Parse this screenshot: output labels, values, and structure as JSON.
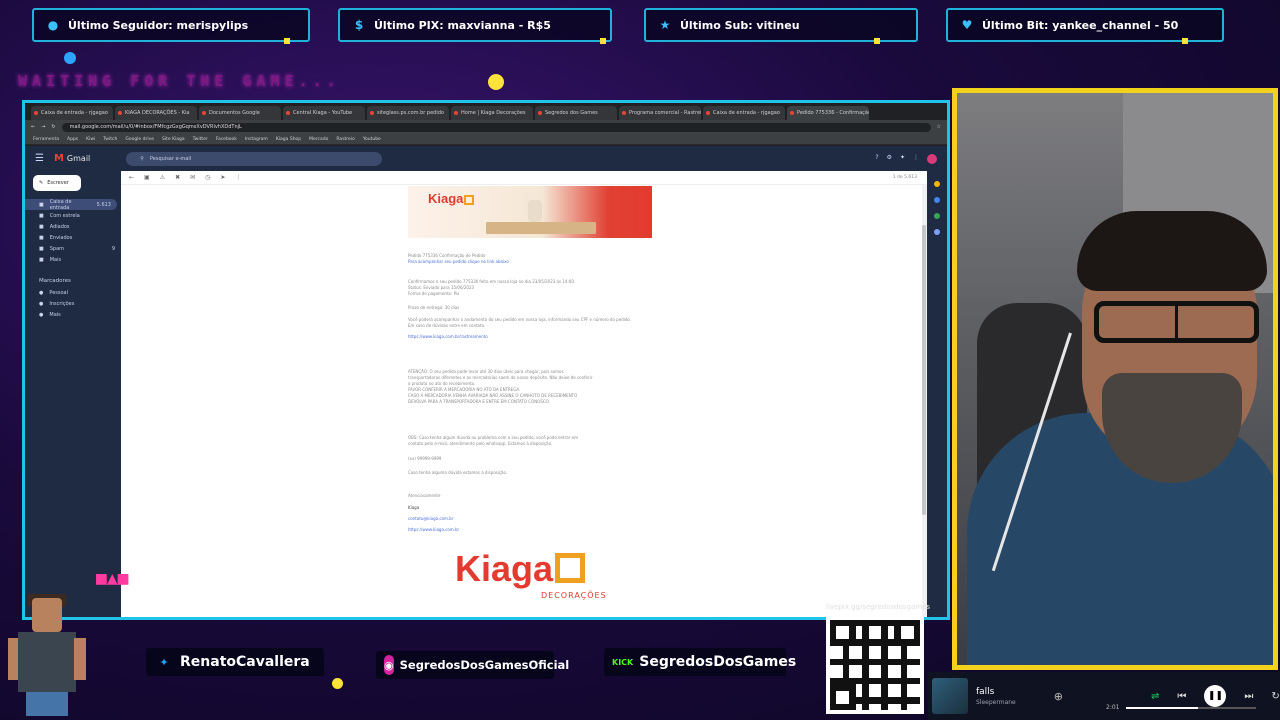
{
  "overlay": {
    "alerts": [
      {
        "icon": "user-icon",
        "label": "Último Seguidor: merispylips"
      },
      {
        "icon": "dollar-icon",
        "label": "Último PIX: maxvianna - R$5"
      },
      {
        "icon": "star-icon",
        "label": "Último Sub: vitineu"
      },
      {
        "icon": "heart-icon",
        "label": "Último Bit: yankee_channel - 50"
      }
    ],
    "waiting_text": "WAITING FOR THE GAME...",
    "socials": [
      {
        "icon": "twitter-icon",
        "label": "RenatoCavallera",
        "color": "#1da1f2"
      },
      {
        "icon": "instagram-icon",
        "label": "SegredosDosGamesOficial",
        "color": "#d6249f"
      },
      {
        "icon": "kick-icon",
        "label": "SegredosDosGames",
        "color": "#53fc18"
      }
    ],
    "qr_label": "livepix.gg/segredosdosgames",
    "accent_color": "#22c3e8",
    "webcam_border_color": "#f2d21c"
  },
  "browser": {
    "tabs": [
      "Caixa de entrada - rjgagao",
      "KIAGA DECORAÇÕES - Kia",
      "Documentos Google",
      "Central Kiaga - YouTube",
      "siteglass.ps.com.br pedido",
      "Home | Kiaga Decorações",
      "Segredos dos Games",
      "Programa comercial - Rastreio",
      "Caixa de entrada - rjgagao",
      "Pedido 775336 - Confirmação"
    ],
    "url": "mail.google.com/mail/u/0/#inbox/FMfcgzGxgGqmsXvDVRlvhXDdTnjL",
    "bookmarks": [
      "Ferramenta",
      "Apps",
      "Kiwi",
      "Twitch",
      "Google drive",
      "Site Kiaga",
      "Twitter",
      "Facebook",
      "Instagram",
      "Kiaga Shop",
      "Mercado",
      "Rastreio",
      "Youtube"
    ]
  },
  "gmail": {
    "app_name": "Gmail",
    "search_placeholder": "Pesquisar e-mail",
    "compose_label": "Escrever",
    "folders": [
      {
        "label": "Caixa de entrada",
        "count": "5.613",
        "active": true
      },
      {
        "label": "Com estrela",
        "count": ""
      },
      {
        "label": "Adiados",
        "count": ""
      },
      {
        "label": "Enviados",
        "count": ""
      },
      {
        "label": "Spam",
        "count": "9"
      },
      {
        "label": "Mais",
        "count": ""
      }
    ],
    "labels_header": "Marcadores",
    "labels": [
      "Pessoal",
      "Inscrições",
      "Mais"
    ],
    "pagination": "1 de 5.613"
  },
  "email": {
    "banner_brand": "Kiaga",
    "lines_1": [
      "Pedido 775336 Confirmação de Pedido",
      "Para acompanhar seu pedido clique no link abaixo"
    ],
    "lines_2": [
      "Confirmamos o seu pedido 775336 feito em nossa loja no dia 23/05/2023 às 14:00.",
      "Status: Enviado para 15/06/2023",
      "Forma de pagamento: Pix"
    ],
    "line_3": "Prazo de entrega: 30 dias",
    "lines_4": [
      "Você poderá acompanhar o andamento do seu pedido em nossa loja, informando seu CPF e número do pedido.",
      "Em caso de dúvidas entre em contato."
    ],
    "link_1": "https://www.kiaga.com.br/rastreamento",
    "lines_5": [
      "ATENÇÃO: O seu pedido pode levar até 30 dias úteis para chegar, pois somos",
      "transportadoras diferentes e as mercadorias saem do nosso depósito. Não deixe de conferir",
      "o produto no ato do recebimento.",
      "FAVOR CONFERIR A MERCADORIA NO ATO DA ENTREGA.",
      "CASO A MERCADORIA VENHA AVARIADA NÃO ASSINE O CANHOTO DE RECEBIMENTO",
      "DEVOLVA PARA A TRANSPORTADORA E ENTRE EM CONTATO CONOSCO."
    ],
    "lines_6": [
      "OBS: Caso tenha algum dúvida ou problema com o seu pedido, você pode entrar em",
      "contato pelo e-mail, atendimento pelo whatsapp. Estamos à disposição."
    ],
    "phone": "(xx) 99999-9999",
    "line_7": "Caso tenha alguma dúvida estamos à disposição.",
    "sign_off": "Atenciosamente",
    "sign_name": "Kiaga",
    "sign_email": "contato@kiaga.com.br",
    "sign_site": "https://www.kiaga.com.br",
    "footer_brand": "Kiaga",
    "footer_sub": "DECORAÇÕES"
  },
  "music": {
    "song": "falls",
    "artist": "Sleepermane",
    "time": "2:01",
    "progress": 0.55
  }
}
